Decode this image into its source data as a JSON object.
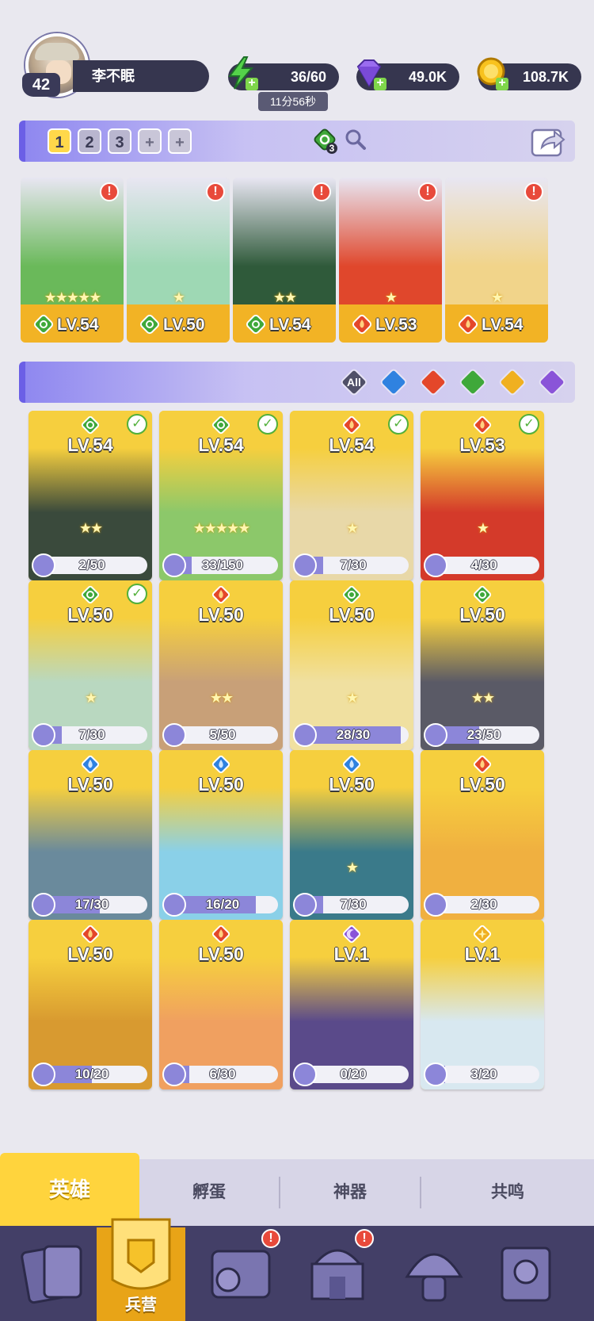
{
  "player": {
    "level": "42",
    "name": "李不眠"
  },
  "resources": {
    "energy": "36/60",
    "energy_timer": "11分56秒",
    "gems": "49.0K",
    "coins": "108.7K"
  },
  "team": {
    "tabs": [
      "1",
      "2",
      "3",
      "+",
      "+"
    ],
    "active_tab": "1",
    "element_count": "3"
  },
  "lineup": [
    {
      "level": "LV.54",
      "element": "forest",
      "stars": "★★★★★",
      "alert": true,
      "art_color": "#6ab95a"
    },
    {
      "level": "LV.50",
      "element": "forest",
      "stars": "★",
      "alert": true,
      "art_color": "#9ed8b4"
    },
    {
      "level": "LV.54",
      "element": "forest",
      "stars": "★★",
      "alert": true,
      "art_color": "#2f5a3a"
    },
    {
      "level": "LV.53",
      "element": "fire",
      "stars": "★",
      "alert": true,
      "art_color": "#e0472c"
    },
    {
      "level": "LV.54",
      "element": "fire",
      "stars": "★",
      "alert": true,
      "art_color": "#f1d48a"
    }
  ],
  "filters": [
    "All",
    "water",
    "fire",
    "forest",
    "light",
    "dark"
  ],
  "heroes": [
    {
      "level": "LV.54",
      "element": "forest",
      "checked": true,
      "stars": "★★",
      "progress": "2/50",
      "frac": 0.04,
      "art_color": "#3a4a3c"
    },
    {
      "level": "LV.54",
      "element": "forest",
      "checked": true,
      "stars": "★★★★★",
      "progress": "33/150",
      "frac": 0.22,
      "art_color": "#8cc86a"
    },
    {
      "level": "LV.54",
      "element": "fire",
      "checked": true,
      "stars": "★",
      "progress": "7/30",
      "frac": 0.23,
      "art_color": "#e8d8a8"
    },
    {
      "level": "LV.53",
      "element": "fire",
      "checked": true,
      "stars": "★",
      "progress": "4/30",
      "frac": 0.13,
      "art_color": "#d43a2a"
    },
    {
      "level": "LV.50",
      "element": "forest",
      "checked": true,
      "stars": "★",
      "progress": "7/30",
      "frac": 0.23,
      "art_color": "#b9d8c0"
    },
    {
      "level": "LV.50",
      "element": "fire",
      "checked": false,
      "stars": "★★",
      "progress": "5/50",
      "frac": 0.1,
      "art_color": "#c8a078"
    },
    {
      "level": "LV.50",
      "element": "forest",
      "checked": false,
      "stars": "★",
      "progress": "28/30",
      "frac": 0.93,
      "art_color": "#f0e0a0"
    },
    {
      "level": "LV.50",
      "element": "forest",
      "checked": false,
      "stars": "★★",
      "progress": "23/50",
      "frac": 0.46,
      "art_color": "#5a5a66"
    },
    {
      "level": "LV.50",
      "element": "water",
      "checked": false,
      "stars": "",
      "progress": "17/30",
      "frac": 0.57,
      "art_color": "#6a8a9c"
    },
    {
      "level": "LV.50",
      "element": "water",
      "checked": false,
      "stars": "",
      "progress": "16/20",
      "frac": 0.8,
      "art_color": "#8ad0e8"
    },
    {
      "level": "LV.50",
      "element": "water",
      "checked": false,
      "stars": "★",
      "progress": "7/30",
      "frac": 0.23,
      "art_color": "#3a7a8a"
    },
    {
      "level": "LV.50",
      "element": "fire",
      "checked": false,
      "stars": "",
      "progress": "2/30",
      "frac": 0.07,
      "art_color": "#f0b040"
    },
    {
      "level": "LV.50",
      "element": "fire",
      "checked": false,
      "stars": "",
      "progress": "10/20",
      "frac": 0.5,
      "art_color": "#d89a30"
    },
    {
      "level": "LV.50",
      "element": "fire",
      "checked": false,
      "stars": "",
      "progress": "6/30",
      "frac": 0.2,
      "art_color": "#f0a060"
    },
    {
      "level": "LV.1",
      "element": "dark",
      "checked": false,
      "stars": "",
      "progress": "0/20",
      "frac": 0.0,
      "art_color": "#5a4a8a"
    },
    {
      "level": "LV.1",
      "element": "light",
      "checked": false,
      "stars": "",
      "progress": "3/20",
      "frac": 0.15,
      "art_color": "#d8e8f0"
    }
  ],
  "subtabs": {
    "heroes": "英雄",
    "hatch": "孵蛋",
    "artifacts": "神器",
    "resonance": "共鸣"
  },
  "nav": {
    "barracks": "兵营"
  },
  "colors": {
    "forest": "#3fa83a",
    "fire": "#e4472a",
    "water": "#2f82e0",
    "light": "#f0b020",
    "dark": "#8a54d8",
    "accent": "#6b5fe6",
    "card_gold": "#f4c23a"
  }
}
